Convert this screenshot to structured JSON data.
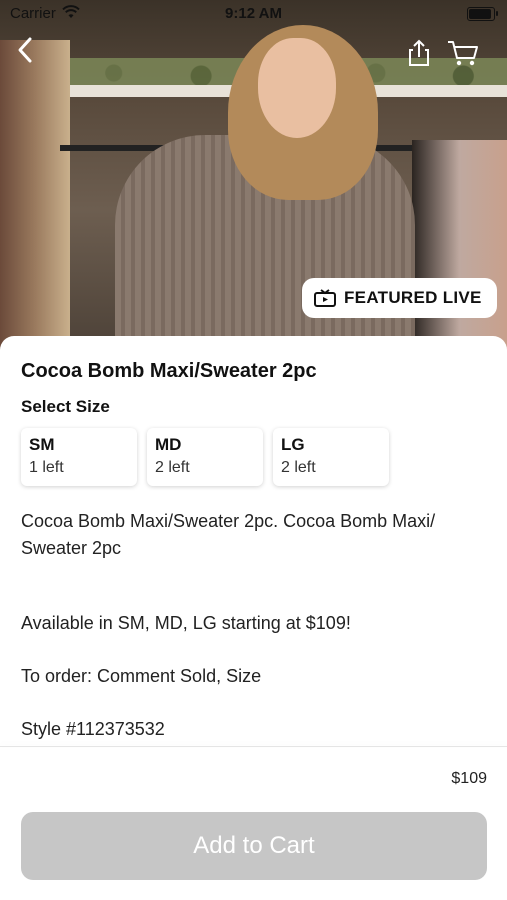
{
  "status_bar": {
    "carrier": "Carrier",
    "time": "9:12 AM"
  },
  "hero": {
    "badge_label": "FEATURED LIVE"
  },
  "product": {
    "title": "Cocoa Bomb Maxi/Sweater 2pc",
    "select_size_label": "Select Size",
    "sizes": [
      {
        "code": "SM",
        "stock": "1 left"
      },
      {
        "code": "MD",
        "stock": "2 left"
      },
      {
        "code": "LG",
        "stock": "2 left"
      }
    ],
    "description": "Cocoa Bomb Maxi/Sweater 2pc. Cocoa Bomb Maxi/ Sweater 2pc",
    "availability": "Available in SM, MD, LG starting at $109!",
    "order_instructions": "To order: Comment Sold, Size",
    "style_number": "Style #112373532"
  },
  "footer": {
    "price": "$109",
    "add_to_cart_label": "Add to Cart"
  },
  "colors": {
    "button_disabled": "#c6c6c6",
    "badge_bg": "#ffffff"
  },
  "icons": [
    "back-chevron-icon",
    "share-icon",
    "cart-icon",
    "tv-icon",
    "wifi-icon",
    "battery-icon"
  ]
}
